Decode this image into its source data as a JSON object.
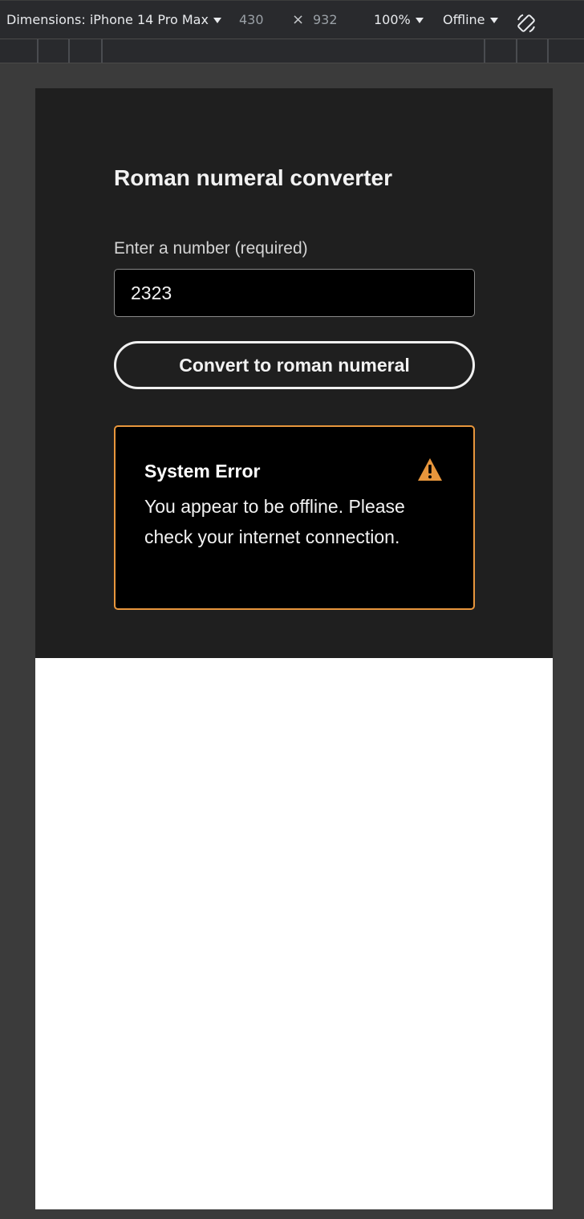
{
  "devtools": {
    "device_label": "Dimensions: iPhone 14 Pro Max",
    "width": "430",
    "times": "×",
    "height": "932",
    "zoom": "100%",
    "throttle": "Offline",
    "rotate_icon": "rotate-icon"
  },
  "app": {
    "title": "Roman numeral converter",
    "input_label": "Enter a number (required)",
    "input_value": "2323",
    "button_label": "Convert to roman numeral",
    "alert": {
      "title": "System Error",
      "message": "You appear to be offline. Please check your internet connection.",
      "icon": "warning-icon",
      "border_color": "#e8963c"
    }
  }
}
